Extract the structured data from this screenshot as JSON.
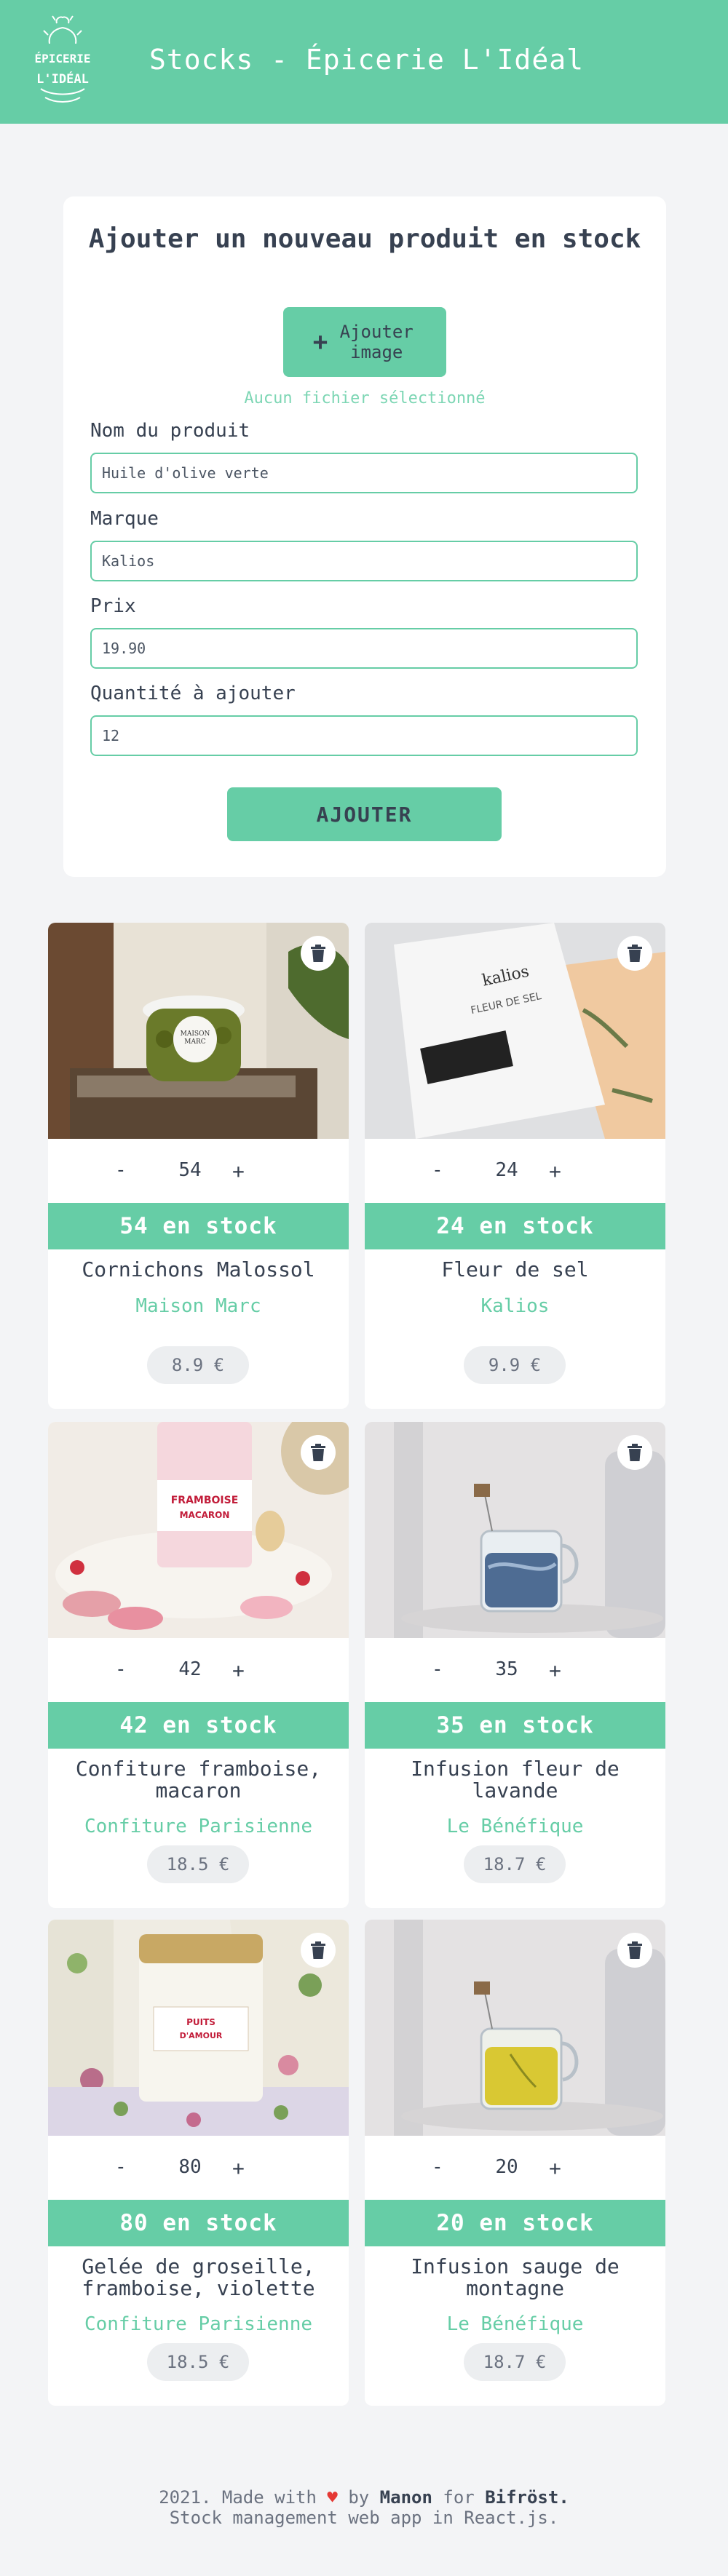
{
  "header": {
    "title": "Stocks - Épicerie L'Idéal",
    "logo_text": [
      "ÉPICERIE",
      "L'IDÉAL"
    ]
  },
  "form": {
    "title": "Ajouter un nouveau produit en stock",
    "add_image_label": "Ajouter image",
    "no_file_text": "Aucun fichier sélectionné",
    "fields": [
      {
        "label": "Nom du produit",
        "value": "Huile d'olive verte"
      },
      {
        "label": "Marque",
        "value": "Kalios"
      },
      {
        "label": "Prix",
        "value": "19.90"
      },
      {
        "label": "Quantité à ajouter",
        "value": "12"
      }
    ],
    "submit_label": "AJOUTER"
  },
  "products": [
    {
      "qty": "54",
      "stock_label": "54 en stock",
      "name": "Cornichons Malossol",
      "brand": "Maison Marc",
      "price": "8.9 €",
      "image": "pickles-jar"
    },
    {
      "qty": "24",
      "stock_label": "24 en stock",
      "name": "Fleur de sel",
      "brand": "Kalios",
      "price": "9.9 €",
      "image": "salt-bag"
    },
    {
      "qty": "42",
      "stock_label": "42 en stock",
      "name": "Confiture framboise, macaron",
      "brand": "Confiture Parisienne",
      "price": "18.5 €",
      "image": "jam-jar"
    },
    {
      "qty": "35",
      "stock_label": "35 en stock",
      "name": "Infusion fleur de lavande",
      "brand": "Le Bénéfique",
      "price": "18.7 €",
      "image": "blue-tea-glass"
    },
    {
      "qty": "80",
      "stock_label": "80 en stock",
      "name": "Gelée de groseille, framboise, violette",
      "brand": "Confiture Parisienne",
      "price": "18.5 €",
      "image": "floral-jar"
    },
    {
      "qty": "20",
      "stock_label": "20 en stock",
      "name": "Infusion sauge de montagne",
      "brand": "Le Bénéfique",
      "price": "18.7 €",
      "image": "yellow-tea-glass"
    }
  ],
  "controls": {
    "minus": "-",
    "plus": "+"
  },
  "footer": {
    "prefix": "2021. Made with",
    "heart": "♥",
    "by": "by",
    "author": "Manon",
    "for": "for",
    "company": "Bifröst.",
    "suffix": "Stock management web app in React.js."
  },
  "colors": {
    "accent": "#66cda6",
    "background": "#f3f4f6",
    "text": "#374151"
  }
}
